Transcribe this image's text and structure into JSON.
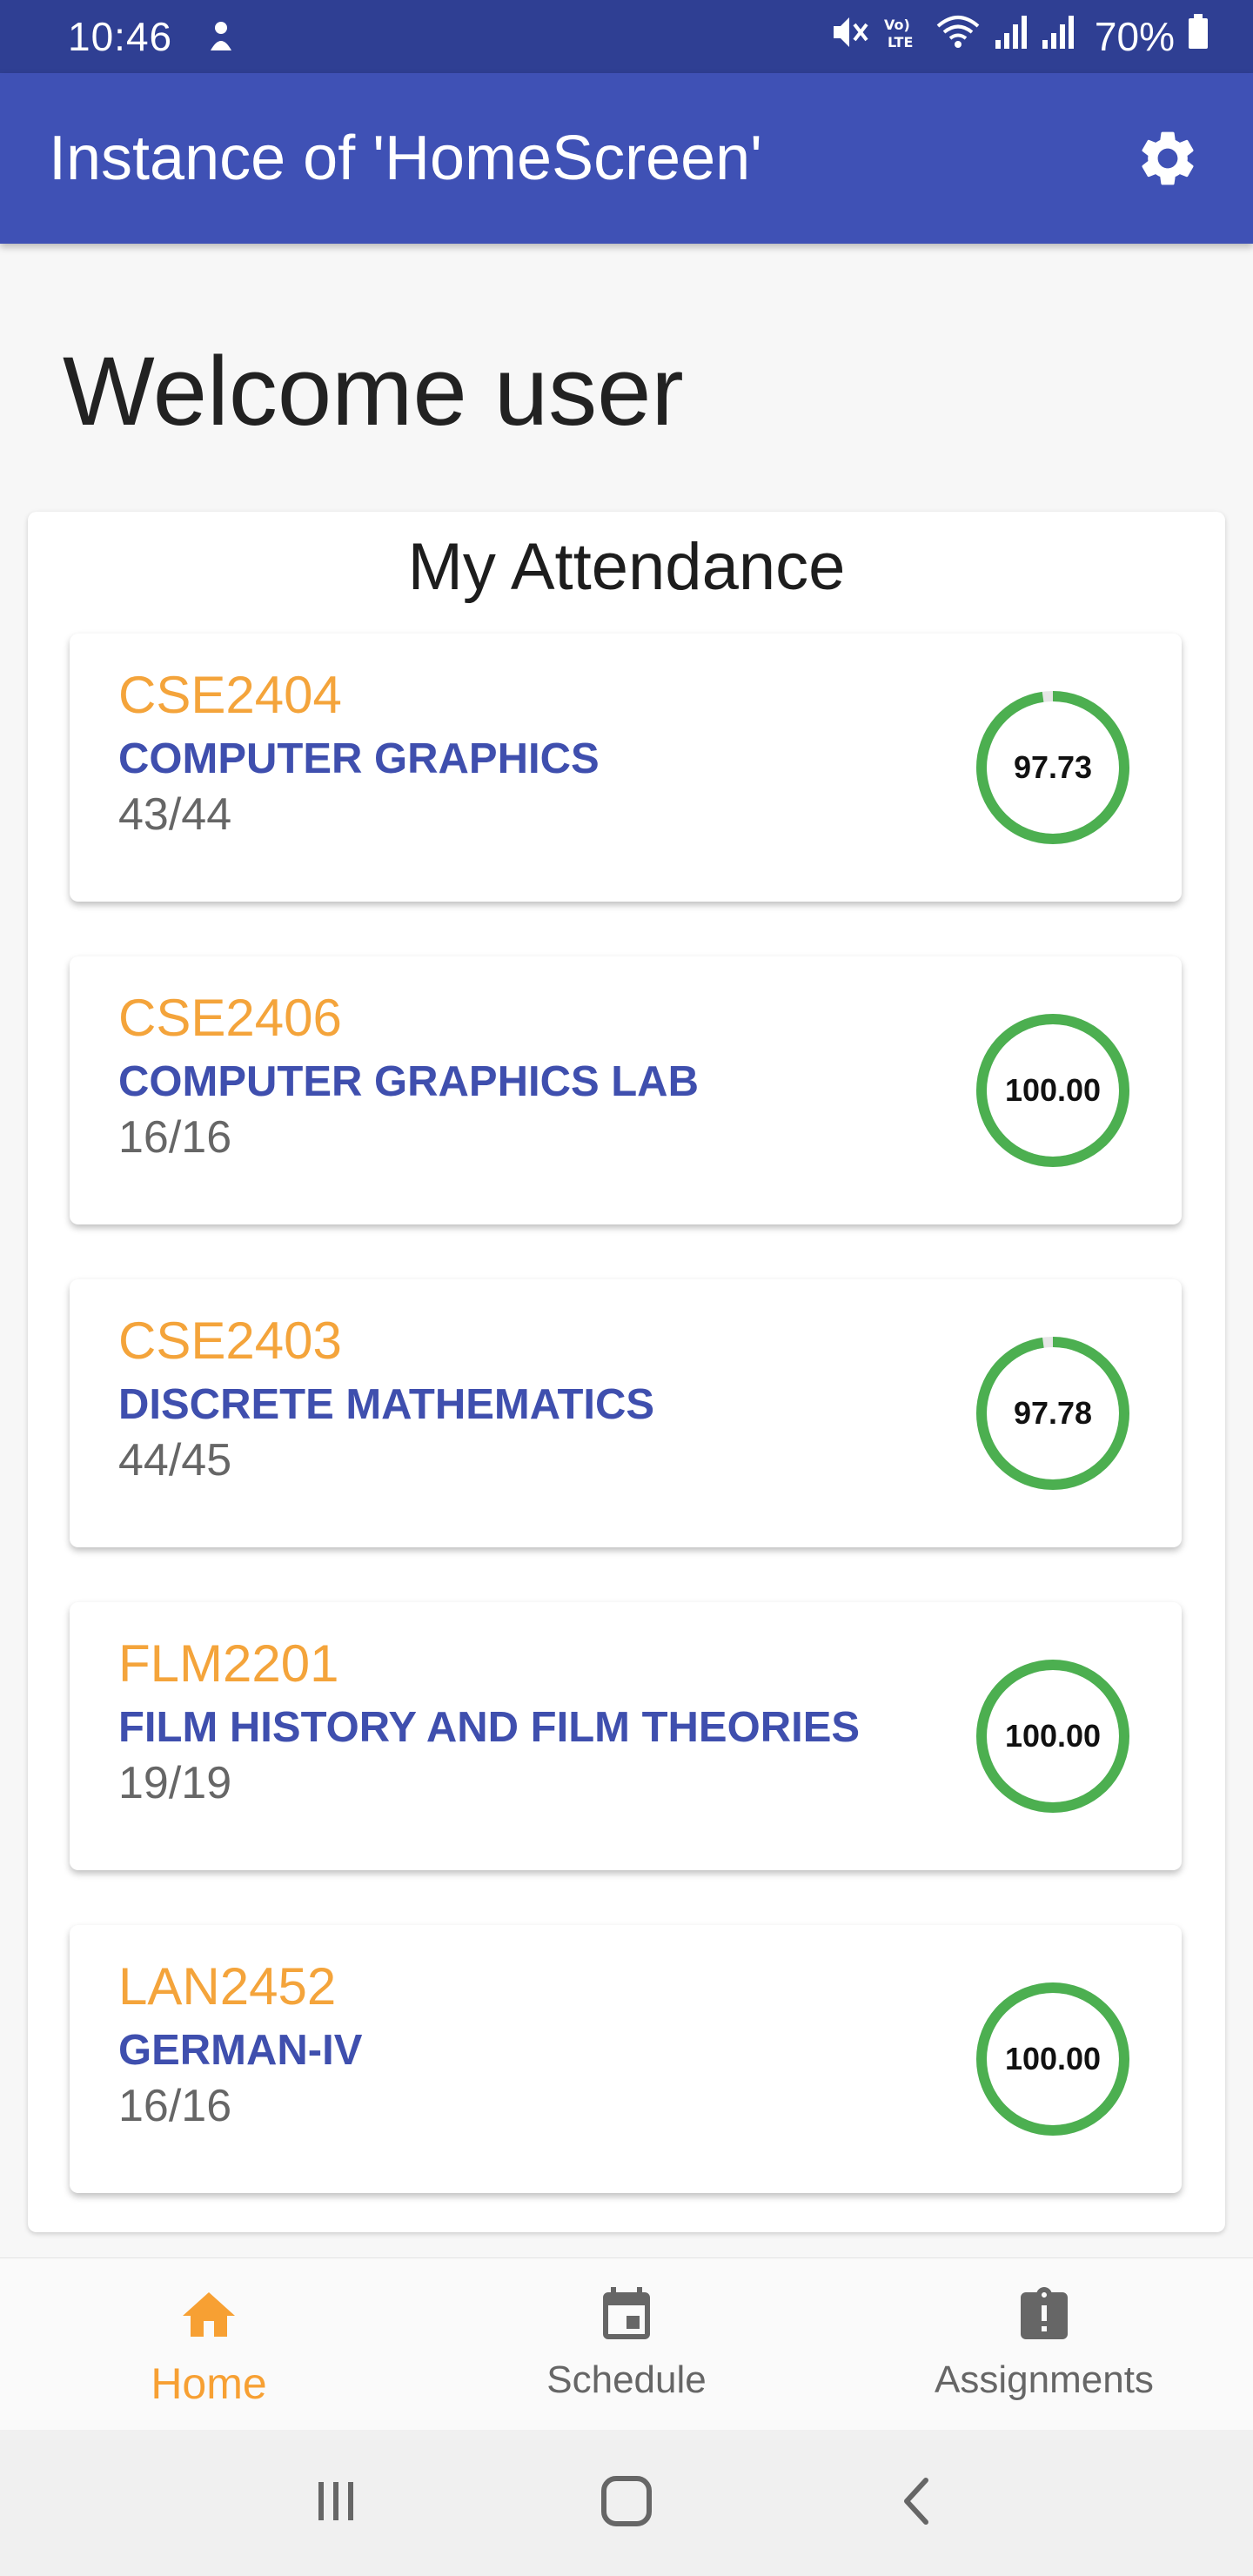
{
  "status_bar": {
    "time": "10:46",
    "battery": "70%"
  },
  "app_bar": {
    "title": "Instance of 'HomeScreen'"
  },
  "welcome": "Welcome user",
  "attendance": {
    "title": "My Attendance",
    "courses": [
      {
        "code": "CSE2404",
        "name": "COMPUTER GRAPHICS",
        "count": "43/44",
        "percent": "97.73",
        "progress": 0.9773
      },
      {
        "code": "CSE2406",
        "name": "COMPUTER GRAPHICS LAB",
        "count": "16/16",
        "percent": "100.00",
        "progress": 1.0
      },
      {
        "code": "CSE2403",
        "name": "DISCRETE MATHEMATICS",
        "count": "44/45",
        "percent": "97.78",
        "progress": 0.9778
      },
      {
        "code": "FLM2201",
        "name": "FILM HISTORY AND FILM THEORIES",
        "count": "19/19",
        "percent": "100.00",
        "progress": 1.0
      },
      {
        "code": "LAN2452",
        "name": "GERMAN-IV",
        "count": "16/16",
        "percent": "100.00",
        "progress": 1.0
      }
    ]
  },
  "bottom_nav": {
    "home": "Home",
    "schedule": "Schedule",
    "assignments": "Assignments"
  },
  "colors": {
    "status_bar": "#2f3f93",
    "app_bar": "#3f51b5",
    "course_code": "#f4a43b",
    "course_name": "#3f4fae",
    "ring": "#4caf50",
    "nav_active": "#f7a033"
  },
  "icons": {
    "settings": "gear-icon",
    "home": "home-icon",
    "schedule": "calendar-icon",
    "assignments": "clipboard-alert-icon"
  }
}
